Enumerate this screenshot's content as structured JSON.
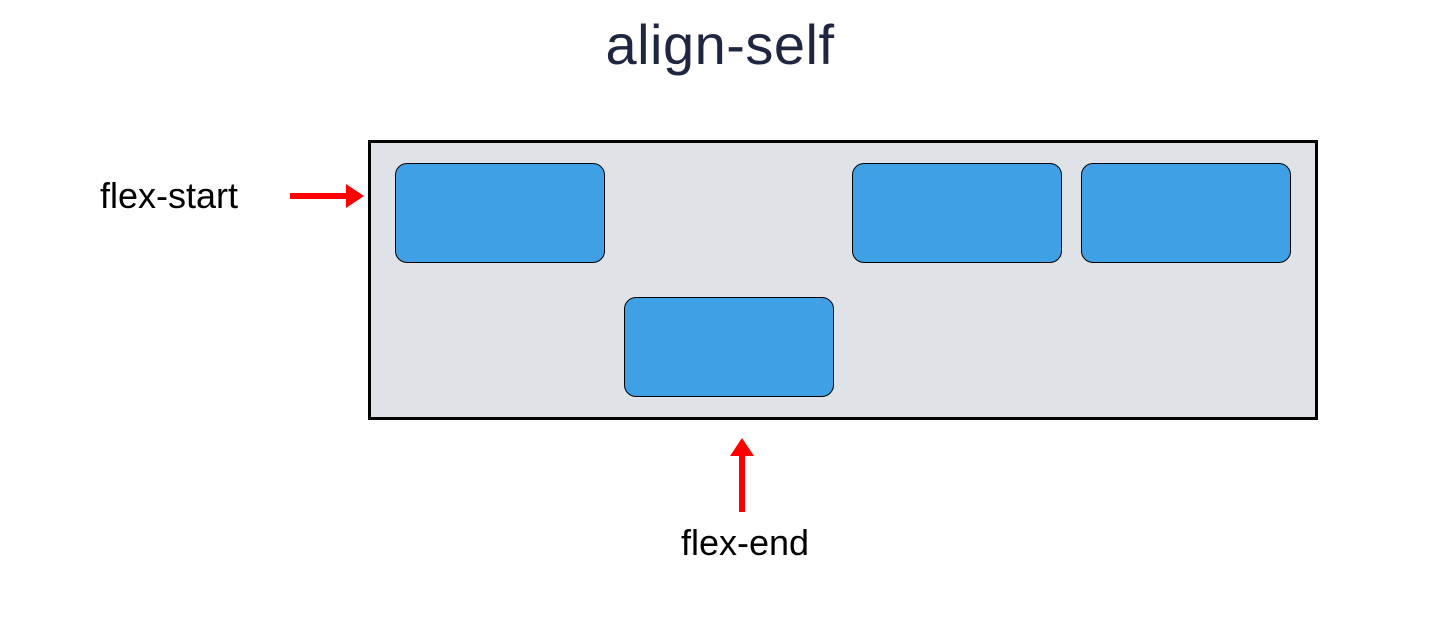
{
  "title": "align-self",
  "labels": {
    "flex_start": "flex-start",
    "flex_end": "flex-end"
  },
  "colors": {
    "item_fill": "#3fa0e6",
    "container_bg": "#dfe2e6",
    "arrow": "#ff0000",
    "title": "#1f2640"
  },
  "container": {
    "item_count": 4,
    "items": [
      {
        "align_self": "flex-start"
      },
      {
        "align_self": "flex-end"
      },
      {
        "align_self": "flex-start"
      },
      {
        "align_self": "flex-start"
      }
    ]
  }
}
